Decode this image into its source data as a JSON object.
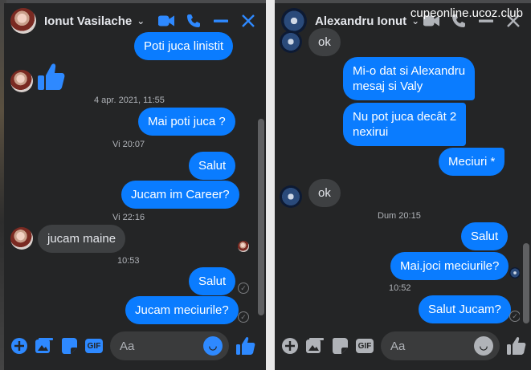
{
  "watermark": "cupeonline.ucoz.club",
  "left_chat": {
    "contact_name": "Ionut Vasilache",
    "messages": {
      "m1": "Poti juca linistit",
      "date1": "4 apr. 2021, 11:55",
      "m2": "Mai poti juca ?",
      "date2": "Vi 20:07",
      "m3": "Salut",
      "m4": "Jucam im Career?",
      "date3": "Vi 22:16",
      "m5": "jucam maine",
      "time1": "10:53",
      "m6": "Salut",
      "m7": "Jucam meciurile?"
    },
    "input_placeholder": "Aa",
    "icons": {
      "header": [
        "chevron-down-icon",
        "video-call-icon",
        "phone-icon",
        "minimize-icon",
        "close-icon"
      ],
      "footer": [
        "plus-icon",
        "photo-icon",
        "sticker-icon",
        "gif-icon",
        "emoji-icon",
        "like-icon"
      ]
    },
    "gif_label": "GIF"
  },
  "right_chat": {
    "contact_name": "Alexandru Ionut",
    "messages": {
      "m0": "ok",
      "m1": "Mi-o  dat si Alexandru\nmesaj si Valy",
      "m2": "Nu pot juca decât 2\nnexirui",
      "m3": "Meciuri *",
      "m4": "ok",
      "date1": "Dum 20:15",
      "m5": "Salut",
      "m6": "Mai.joci meciurile?",
      "time1": "10:52",
      "m7": "Salut Jucam?"
    },
    "input_placeholder": "Aa",
    "gif_label": "GIF"
  },
  "colors": {
    "outgoing": "#0a7cff",
    "incoming": "#3e4042",
    "panel": "#242526",
    "accent_active": "#2e89ff",
    "accent_inactive": "#b0b3b8"
  }
}
